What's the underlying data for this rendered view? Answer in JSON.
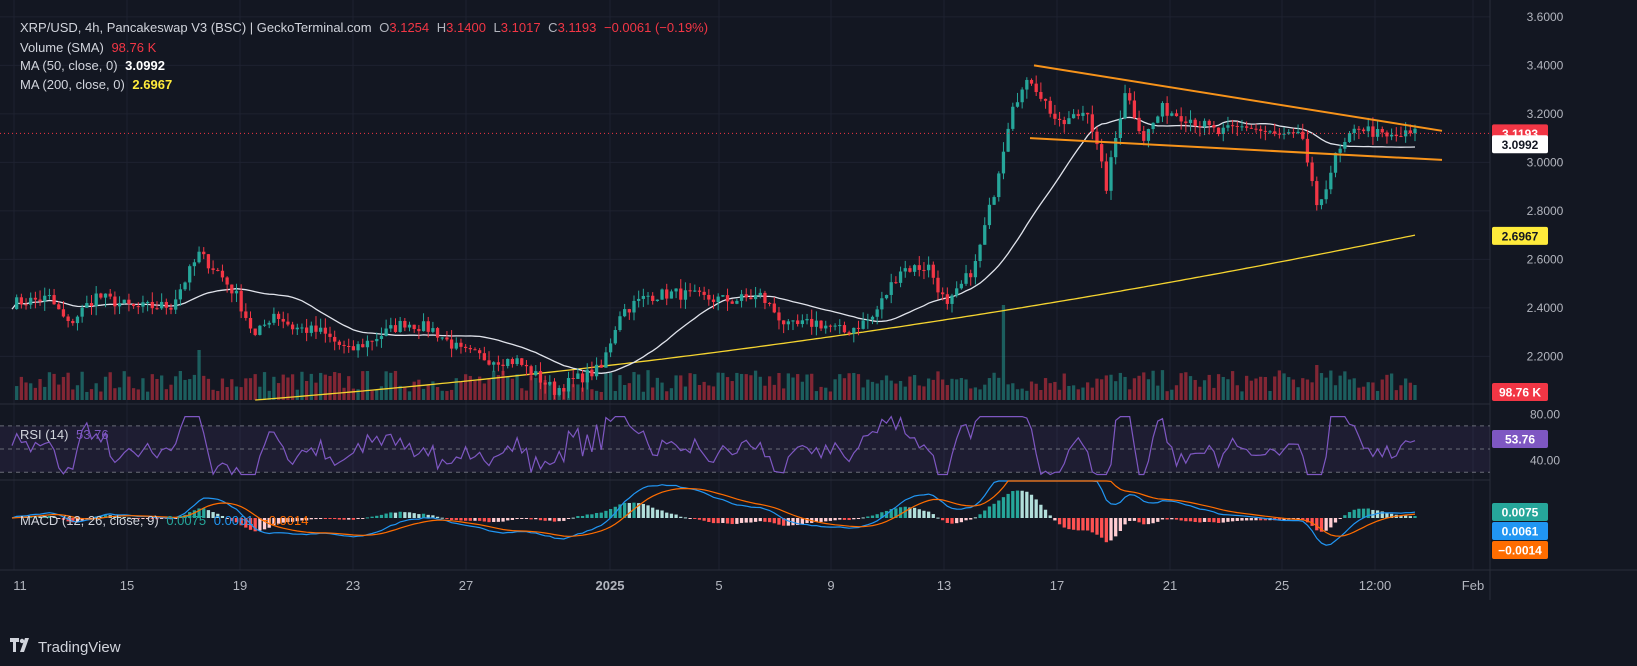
{
  "header": {
    "symbol": "XRP/USD, 4h, Pancakeswap V3 (BSC) | GeckoTerminal.com",
    "o_label": "O",
    "o": "3.1254",
    "h_label": "H",
    "h": "3.1400",
    "l_label": "L",
    "l": "3.1017",
    "c_label": "C",
    "c": "3.1193",
    "change": "−0.0061 (−0.19%)"
  },
  "legend": {
    "volume_label": "Volume (SMA)",
    "volume_value": "98.76 K",
    "ma50_label": "MA (50, close, 0)",
    "ma50_value": "3.0992",
    "ma200_label": "MA (200, close, 0)",
    "ma200_value": "2.6967",
    "rsi_label": "RSI (14)",
    "rsi_value": "53.76",
    "macd_label": "MACD (12, 26, close, 9)",
    "macd_value": "0.0075",
    "signal_value": "0.0061",
    "hist_value": "−0.0014"
  },
  "colors": {
    "up": "#26a69a",
    "down": "#f23645",
    "ma50": "#e0e3eb",
    "ma200": "#f5d430",
    "wedge": "#f7931a",
    "rsi": "#7e57c2",
    "macd": "#2196f3",
    "signal": "#ff6d00"
  },
  "branding": {
    "name": "TradingView",
    "icon": "tradingview-logo-icon"
  },
  "chart_data": {
    "type": "candlestick",
    "price_axis": {
      "ticks": [
        2.2,
        2.4,
        2.6,
        2.8,
        3.0,
        3.2,
        3.4,
        3.6
      ],
      "range": [
        2.02,
        3.62
      ]
    },
    "rsi_axis": {
      "ticks": [
        40,
        80
      ],
      "range": [
        25,
        88
      ]
    },
    "x_ticks": [
      "11",
      "15",
      "19",
      "23",
      "27",
      "2025",
      "5",
      "9",
      "13",
      "17",
      "21",
      "25",
      "12:00",
      "Feb"
    ],
    "last_price": "3.1193",
    "labels": {
      "price": "3.1193",
      "ma50": "3.0992",
      "ma200": "2.6967",
      "volume": "98.76 K",
      "rsi": "53.76",
      "macd": "0.0075",
      "signal": "0.0061",
      "hist": "−0.0014",
      "macd_hidden_tick": "0.0400"
    },
    "anchors": [
      [
        0,
        2.42
      ],
      [
        8,
        2.44
      ],
      [
        12,
        2.33
      ],
      [
        18,
        2.45
      ],
      [
        26,
        2.4
      ],
      [
        34,
        2.41
      ],
      [
        40,
        2.62
      ],
      [
        44,
        2.55
      ],
      [
        48,
        2.45
      ],
      [
        52,
        2.28
      ],
      [
        56,
        2.38
      ],
      [
        60,
        2.32
      ],
      [
        66,
        2.3
      ],
      [
        72,
        2.22
      ],
      [
        78,
        2.28
      ],
      [
        84,
        2.34
      ],
      [
        90,
        2.31
      ],
      [
        96,
        2.22
      ],
      [
        102,
        2.19
      ],
      [
        108,
        2.18
      ],
      [
        112,
        2.12
      ],
      [
        116,
        2.06
      ],
      [
        120,
        2.1
      ],
      [
        126,
        2.15
      ],
      [
        130,
        2.38
      ],
      [
        136,
        2.45
      ],
      [
        142,
        2.46
      ],
      [
        148,
        2.44
      ],
      [
        154,
        2.43
      ],
      [
        160,
        2.45
      ],
      [
        166,
        2.32
      ],
      [
        172,
        2.34
      ],
      [
        178,
        2.3
      ],
      [
        184,
        2.36
      ],
      [
        190,
        2.56
      ],
      [
        196,
        2.57
      ],
      [
        200,
        2.4
      ],
      [
        206,
        2.58
      ],
      [
        210,
        2.88
      ],
      [
        214,
        3.25
      ],
      [
        218,
        3.34
      ],
      [
        224,
        3.15
      ],
      [
        230,
        3.22
      ],
      [
        234,
        2.9
      ],
      [
        238,
        3.3
      ],
      [
        242,
        3.1
      ],
      [
        246,
        3.22
      ],
      [
        252,
        3.18
      ],
      [
        258,
        3.12
      ],
      [
        264,
        3.15
      ],
      [
        270,
        3.11
      ],
      [
        276,
        3.1
      ],
      [
        279,
        2.8
      ],
      [
        283,
        3.02
      ],
      [
        288,
        3.15
      ],
      [
        294,
        3.1
      ],
      [
        300,
        3.12
      ]
    ],
    "wedge_upper": [
      [
        3.4
      ],
      [
        3.13
      ]
    ],
    "wedge_lower": [
      [
        3.1
      ],
      [
        3.01
      ]
    ]
  }
}
